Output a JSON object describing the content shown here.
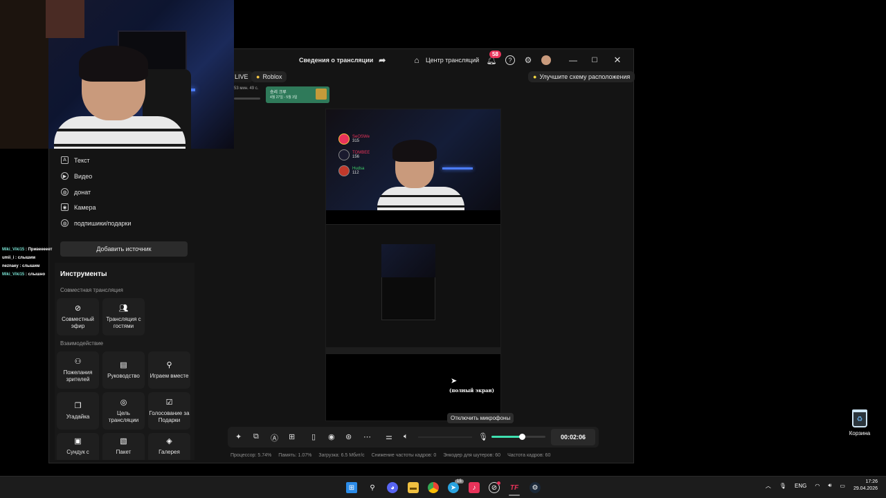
{
  "app": {
    "stream_info_title": "Сведения о трансляции",
    "stream_center": "Центр трансляций",
    "notifications_count": "58",
    "live_chip": "LIVE",
    "category_chip": "Roblox",
    "layout_hint": "Улучшите схему расположения",
    "event_card_time": "53 мин. 49 с.",
    "event_card_title": "승리 크루",
    "event_card_sub": "4월 27일 - 5월 3일"
  },
  "sources": {
    "items": [
      {
        "label": "Текст",
        "icon": "text-icon"
      },
      {
        "label": "Видео",
        "icon": "play-icon"
      },
      {
        "label": "донат",
        "icon": "globe-icon"
      },
      {
        "label": "Камера",
        "icon": "camera-icon"
      },
      {
        "label": "подпишики/подарки",
        "icon": "globe-icon"
      }
    ],
    "add_button": "Добавить источник"
  },
  "tools": {
    "title": "Инструменты",
    "collab_title": "Совместная трансляция",
    "collab": [
      {
        "label": "Совместный эфир",
        "icon": "link-icon"
      },
      {
        "label": "Трансляция с гостями",
        "icon": "guests-icon"
      }
    ],
    "interaction_title": "Взаимодействие",
    "interaction": [
      {
        "label": "Пожелания зрителей",
        "icon": "wishes-icon"
      },
      {
        "label": "Руководство",
        "icon": "guide-icon"
      },
      {
        "label": "Играем вместе",
        "icon": "play-together-icon"
      },
      {
        "label": "Угадайка",
        "icon": "guess-icon"
      },
      {
        "label": "Цель трансляции",
        "icon": "target-icon"
      },
      {
        "label": "Голосование за Подарки",
        "icon": "vote-icon"
      },
      {
        "label": "Сундук с",
        "icon": "chest-icon"
      },
      {
        "label": "Пакет",
        "icon": "package-icon"
      },
      {
        "label": "Галерея",
        "icon": "gallery-icon"
      }
    ]
  },
  "chat": [
    {
      "user": "Miki_Viki15",
      "msg": "Привееееет",
      "style": "u1"
    },
    {
      "user": "umii_i",
      "msg": "слышим",
      "style": "u2"
    },
    {
      "user": "neznaey",
      "msg": "слышим",
      "style": "u2"
    },
    {
      "user": "Miki_Viki15",
      "msg": "слышно",
      "style": "u1"
    }
  ],
  "preview": {
    "ranking": [
      {
        "name": "SeOSWe",
        "score": "315",
        "color": "#e8335a"
      },
      {
        "name": "TOMBEE",
        "score": "156",
        "color": "#e8335a"
      },
      {
        "name": "Hudsa",
        "score": "112",
        "color": "#3fd06b"
      }
    ],
    "caption_line1": "(полный экран)"
  },
  "controls": {
    "timer": "00:02:06",
    "mic_tooltip": "Отключить микрофоны",
    "mic_level": 0.55
  },
  "stats": {
    "cpu": "Процессор: 5.74%",
    "mem": "Память: 1.07%",
    "load": "Загрузка: 6.5 Мбит/с",
    "drop": "Снижение частоты кадров: 0",
    "encoder": "Энкодер для шутеров: 60",
    "fps": "Частота кадров: 60"
  },
  "desktop": {
    "recycle_bin": "Корзина"
  },
  "taskbar": {
    "lang": "ENG",
    "time": "17:26",
    "date": "29.04.2026",
    "telegram_badge": "15"
  }
}
